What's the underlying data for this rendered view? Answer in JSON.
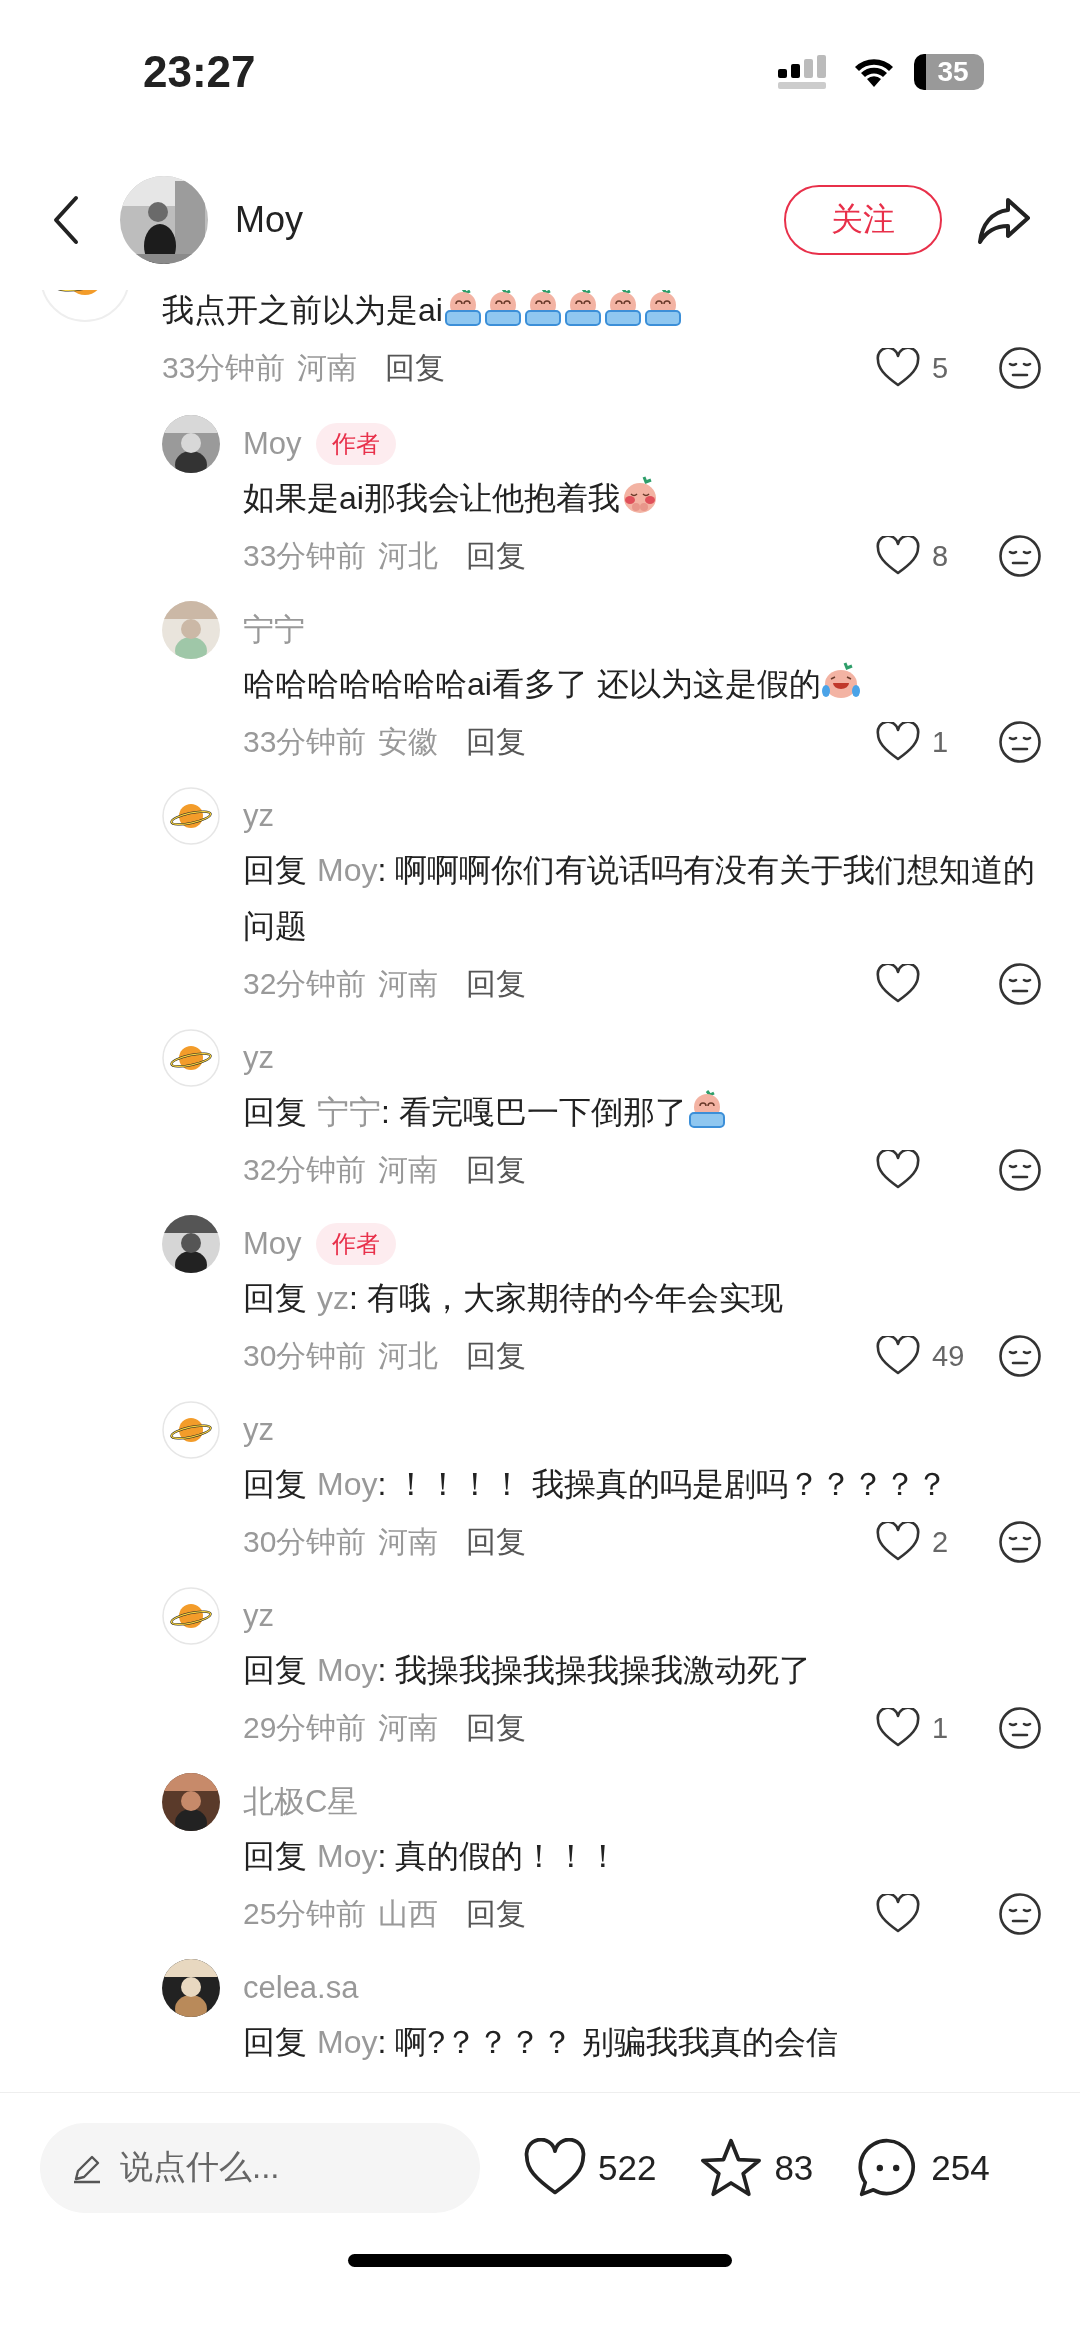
{
  "status_bar": {
    "time": "23:27",
    "battery": "35"
  },
  "header": {
    "username": "Moy",
    "follow_button": "关注"
  },
  "comments": [
    {
      "avatar": {
        "kind": "planet"
      },
      "text": "我点开之前以为是ai",
      "emoji": [
        {
          "kind": "crying"
        },
        {
          "kind": "crying"
        },
        {
          "kind": "crying"
        },
        {
          "kind": "crying"
        },
        {
          "kind": "crying"
        },
        {
          "kind": "crying"
        }
      ],
      "time": "33分钟前",
      "location": "河南",
      "reply_button": "回复",
      "likes": "5",
      "replies": [
        {
          "name": "Moy",
          "badge": "作者",
          "text": "如果是ai那我会让他抱着我",
          "emoji": [
            {
              "kind": "shy"
            }
          ],
          "time": "33分钟前",
          "location": "河北",
          "reply_button": "回复",
          "likes": "8"
        },
        {
          "name": "宁宁",
          "text": "哈哈哈哈哈哈哈ai看多了 还以为这是假的",
          "emoji": [
            {
              "kind": "laughing"
            }
          ],
          "time": "33分钟前",
          "location": "安徽",
          "reply_button": "回复",
          "likes": "1"
        },
        {
          "avatar": {
            "kind": "planet"
          },
          "name": "yz",
          "reply_prefix": "回复",
          "reply_to": "Moy",
          "text": ": 啊啊啊你们有说话吗有没有关于我们想知道的问题",
          "time": "32分钟前",
          "location": "河南",
          "reply_button": "回复"
        },
        {
          "avatar": {
            "kind": "planet"
          },
          "name": "yz",
          "reply_prefix": "回复",
          "reply_to": "宁宁",
          "text": ": 看完嘎巴一下倒那了",
          "emoji": [
            {
              "kind": "crying"
            }
          ],
          "time": "32分钟前",
          "location": "河南",
          "reply_button": "回复"
        },
        {
          "name": "Moy",
          "badge": "作者",
          "reply_prefix": "回复",
          "reply_to": "yz",
          "text": ": 有哦，大家期待的今年会实现",
          "time": "30分钟前",
          "location": "河北",
          "reply_button": "回复",
          "likes": "49"
        },
        {
          "avatar": {
            "kind": "planet"
          },
          "name": "yz",
          "reply_prefix": "回复",
          "reply_to": "Moy",
          "text": ": ！！！！ 我操真的吗是剧吗？？？？？",
          "time": "30分钟前",
          "location": "河南",
          "reply_button": "回复",
          "likes": "2"
        },
        {
          "avatar": {
            "kind": "planet"
          },
          "name": "yz",
          "reply_prefix": "回复",
          "reply_to": "Moy",
          "text": ": 我操我操我操我操我激动死了",
          "time": "29分钟前",
          "location": "河南",
          "reply_button": "回复",
          "likes": "1"
        },
        {
          "name": "北极C星",
          "reply_prefix": "回复",
          "reply_to": "Moy",
          "text": ": 真的假的！！！",
          "time": "25分钟前",
          "location": "山西",
          "reply_button": "回复"
        },
        {
          "name": "celea.sa",
          "reply_prefix": "回复",
          "reply_to": "Moy",
          "text": ": 啊?？？？？ 别骗我我真的会信"
        }
      ]
    }
  ],
  "bottom_bar": {
    "placeholder": "说点什么...",
    "likes": "522",
    "stars": "83",
    "comments": "254"
  }
}
